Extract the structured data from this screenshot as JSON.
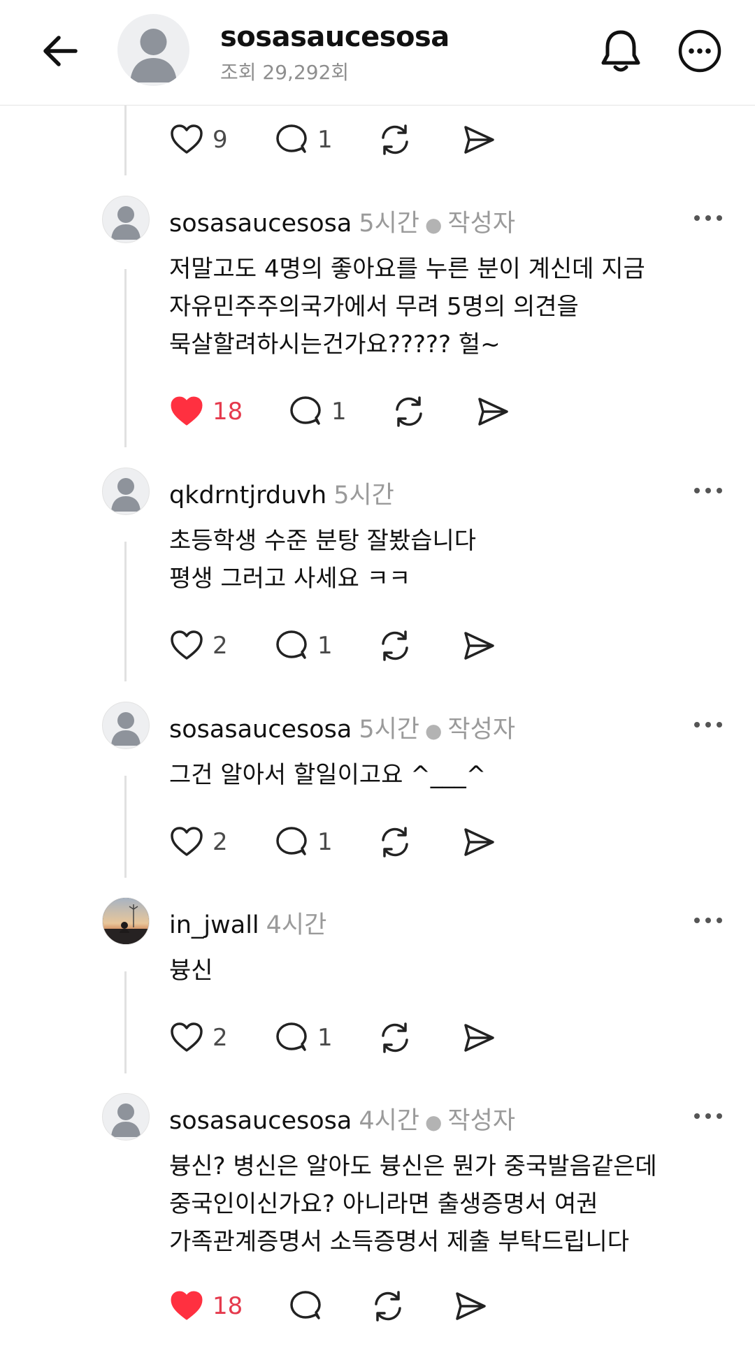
{
  "header": {
    "username": "sosasaucesosa",
    "views": "조회 29,292회",
    "icons": [
      "back-arrow-icon",
      "avatar-placeholder",
      "bell-icon",
      "more-circle-icon"
    ]
  },
  "top_actions": {
    "likes": "9",
    "replies": "1"
  },
  "comments": [
    {
      "username": "sosasaucesosa",
      "time": "5시간",
      "author_badge": "작성자",
      "lines": [
        "저말고도 4명의 좋아요를 누른 분이 계신데 지금",
        "자유민주주의국가에서 무려 5명의 의견을",
        "묵살할려하시는건가요????? 헐~"
      ],
      "likes": "18",
      "liked": true,
      "replies": "1"
    },
    {
      "username": "qkdrntjrduvh",
      "time": "5시간",
      "author_badge": "",
      "lines": [
        "초등학생 수준 분탕 잘봤습니다",
        "평생 그러고 사세요 ㅋㅋ"
      ],
      "likes": "2",
      "liked": false,
      "replies": "1"
    },
    {
      "username": "sosasaucesosa",
      "time": "5시간",
      "author_badge": "작성자",
      "lines": [
        "그건 알아서 할일이고요 ^___^"
      ],
      "likes": "2",
      "liked": false,
      "replies": "1"
    },
    {
      "username": "in_jwall",
      "time": "4시간",
      "author_badge": "",
      "lines": [
        "븅신"
      ],
      "likes": "2",
      "liked": false,
      "replies": "1"
    },
    {
      "username": "sosasaucesosa",
      "time": "4시간",
      "author_badge": "작성자",
      "lines": [
        "븅신? 병신은 알아도 븅신은 뭔가 중국발음같은데",
        "중국인이신가요? 아니라면 출생증명서 여권",
        "가족관계증명서 소득증명서 제출 부탁드립니다"
      ],
      "likes": "18",
      "liked": true,
      "replies": ""
    }
  ],
  "colors": {
    "like_red": "#ff3040",
    "like_count_red": "#e53a4d",
    "meta_gray": "#9a9a9a",
    "icon_dark": "#222222"
  }
}
